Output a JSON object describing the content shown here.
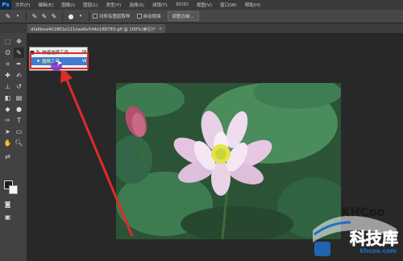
{
  "app": {
    "logo": "Ps",
    "menu": [
      "文件(F)",
      "编辑(E)",
      "图像(I)",
      "图层(L)",
      "类型(Y)",
      "选择(S)",
      "滤镜(T)",
      "3D(D)",
      "视图(V)",
      "窗口(W)",
      "帮助(H)"
    ]
  },
  "options_bar": {
    "sample_all_layers": "对所有图层取样",
    "auto_enhance": "自动增强",
    "refine_edge": "调整边缘..."
  },
  "document": {
    "tab_title": "dfa6bea401861e111eaa6e544e188783.gif @ 100%(索引)*",
    "close_glyph": "×"
  },
  "tool_flyout": {
    "items": [
      {
        "label": "快速选择工具",
        "shortcut": "W",
        "icon": "quick-selection-icon",
        "selected": false
      },
      {
        "label": "魔棒工具",
        "shortcut": "W",
        "icon": "magic-wand-icon",
        "selected": true
      }
    ]
  },
  "watermark": {
    "brand": "KHCoo",
    "title": "科技库",
    "url": "khcoo.com"
  },
  "colors": {
    "annotation": "#e02a2a",
    "selected_item": "#3e7dcf"
  }
}
